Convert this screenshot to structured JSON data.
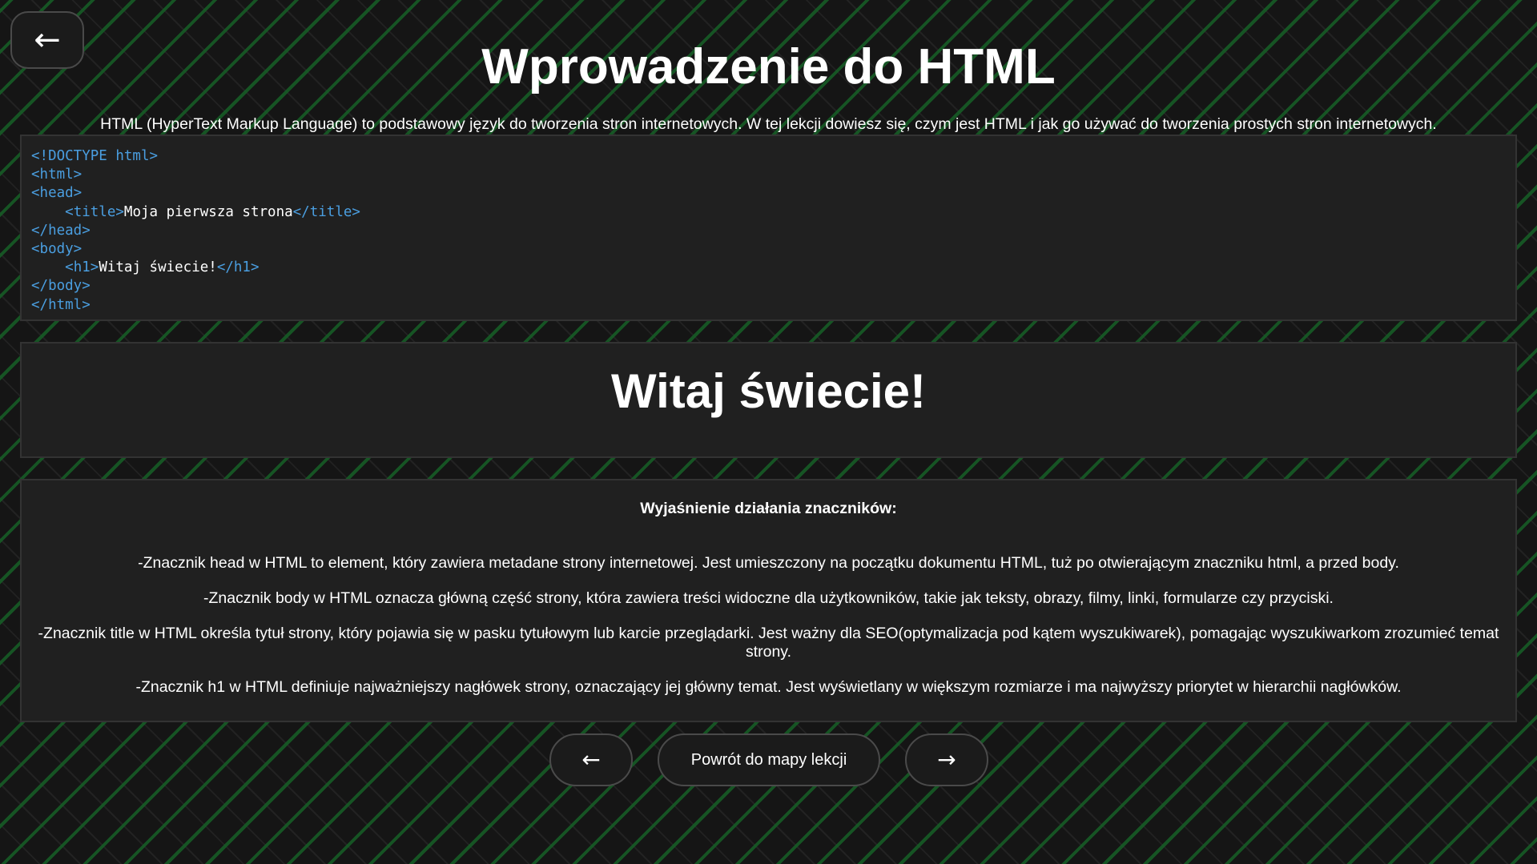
{
  "header": {
    "back_icon": "←",
    "title": "Wprowadzenie do HTML",
    "intro": "HTML (HyperText Markup Language) to podstawowy język do tworzenia stron internetowych. W tej lekcji dowiesz się, czym jest HTML i jak go używać do tworzenia prostych stron internetowych."
  },
  "code": {
    "doctype": "<!DOCTYPE html>",
    "html_open": "<html>",
    "head_open": "<head>",
    "title_open": "<title>",
    "title_text": "Moja pierwsza strona",
    "title_close": "</title>",
    "head_close": "</head>",
    "body_open": "<body>",
    "h1_open": "<h1>",
    "h1_text": "Witaj świecie!",
    "h1_close": "</h1>",
    "body_close": "</body>",
    "html_close": "</html>"
  },
  "preview": {
    "heading": "Witaj świecie!"
  },
  "explanation": {
    "heading": "Wyjaśnienie działania znaczników:",
    "items": [
      "-Znacznik head w HTML to element, który zawiera metadane strony internetowej. Jest umieszczony na początku dokumentu HTML, tuż po otwierającym znaczniku html, a przed body.",
      "-Znacznik body w HTML oznacza główną część strony, która zawiera treści widoczne dla użytkowników, takie jak teksty, obrazy, filmy, linki, formularze czy przyciski.",
      "-Znacznik title w HTML określa tytuł strony, który pojawia się w pasku tytułowym lub karcie przeglądarki. Jest ważny dla SEO(optymalizacja pod kątem wyszukiwarek), pomagając wyszukiwarkom zrozumieć temat strony.",
      "-Znacznik h1 w HTML definiuje najważniejszy nagłówek strony, oznaczający jej główny temat. Jest wyświetlany w większym rozmiarze i ma najwyższy priorytet w hierarchii nagłówków."
    ]
  },
  "nav": {
    "prev_icon": "←",
    "map_label": "Powrót do mapy lekcji",
    "next_icon": "→"
  },
  "colors": {
    "background": "#151515",
    "stripe": "#165f26",
    "panel": "#202020",
    "code_tag": "#4a9ee0",
    "text": "#ffffff"
  }
}
